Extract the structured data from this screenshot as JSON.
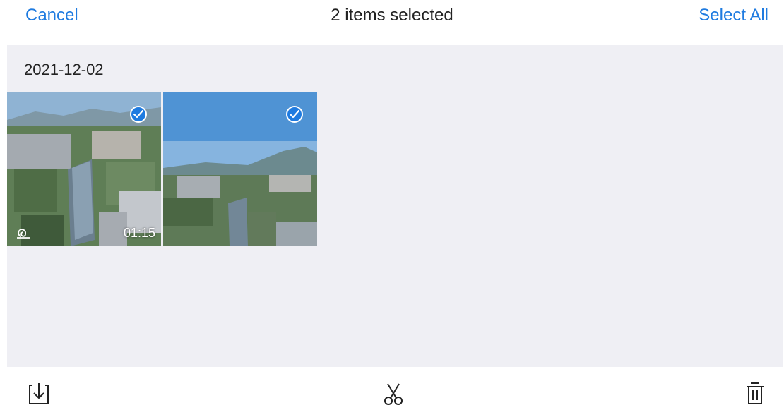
{
  "header": {
    "cancel_label": "Cancel",
    "title": "2 items selected",
    "select_all_label": "Select All"
  },
  "album": {
    "date_label": "2021-12-02",
    "items": [
      {
        "type": "video",
        "selected": true,
        "duration": "01:15",
        "icon": "hyperlapse-icon"
      },
      {
        "type": "photo",
        "selected": true
      }
    ]
  },
  "toolbar": {
    "items": [
      {
        "name": "download-icon"
      },
      {
        "name": "scissors-icon"
      },
      {
        "name": "trash-icon"
      }
    ]
  },
  "colors": {
    "accent": "#1f7be0",
    "background": "#efeff4",
    "text": "#222222"
  }
}
